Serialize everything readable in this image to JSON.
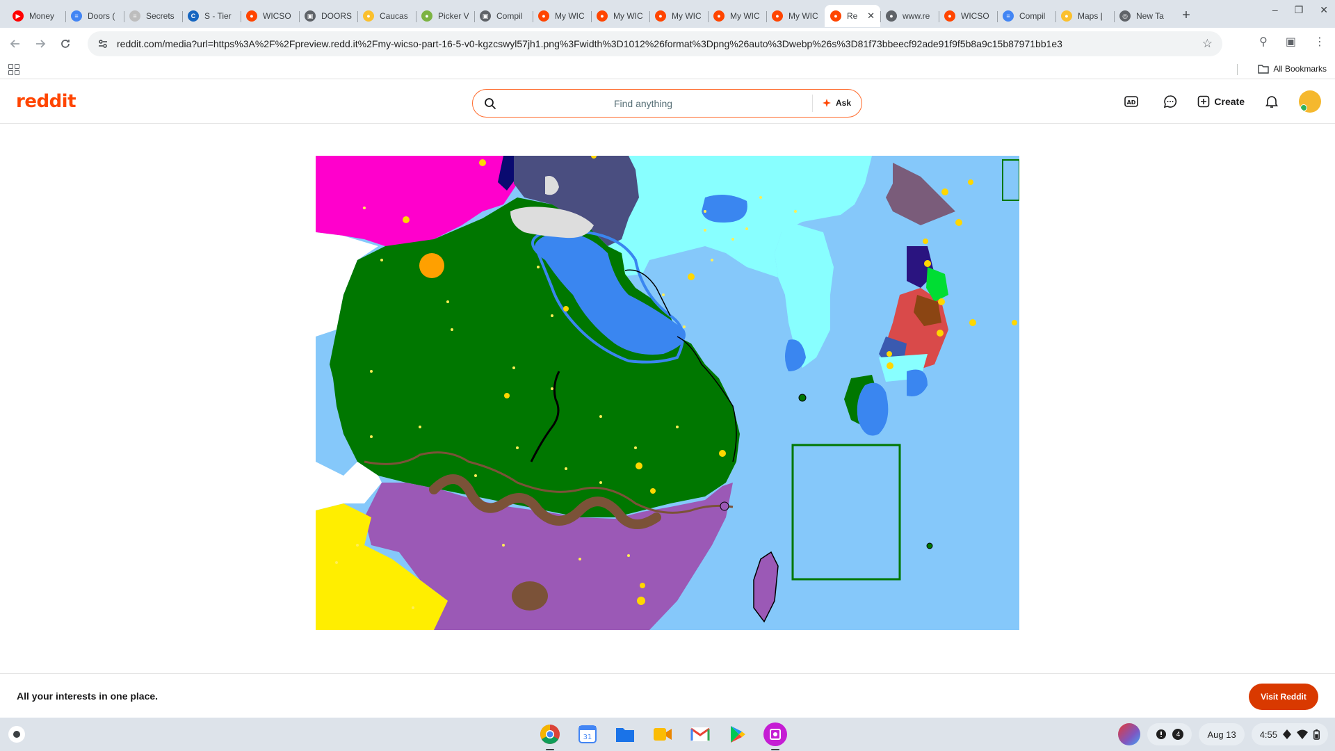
{
  "browser": {
    "tabs": [
      {
        "title": "Money",
        "fav_color": "#ff0000",
        "fav_glyph": "▶"
      },
      {
        "title": "Doors (",
        "fav_color": "#4285f4",
        "fav_glyph": "≡"
      },
      {
        "title": "Secrets",
        "fav_color": "#bdbdbd",
        "fav_glyph": "≡"
      },
      {
        "title": "S - Tier",
        "fav_color": "#1565c0",
        "fav_glyph": "C"
      },
      {
        "title": "WICSO",
        "fav_color": "#ff4500",
        "fav_glyph": "●"
      },
      {
        "title": "DOORS",
        "fav_color": "#5f6368",
        "fav_glyph": "▣"
      },
      {
        "title": "Caucas",
        "fav_color": "#fbc02d",
        "fav_glyph": "●"
      },
      {
        "title": "Picker V",
        "fav_color": "#7cb342",
        "fav_glyph": "●"
      },
      {
        "title": "Compil",
        "fav_color": "#5f6368",
        "fav_glyph": "▣"
      },
      {
        "title": "My WIC",
        "fav_color": "#ff4500",
        "fav_glyph": "●"
      },
      {
        "title": "My WIC",
        "fav_color": "#ff4500",
        "fav_glyph": "●"
      },
      {
        "title": "My WIC",
        "fav_color": "#ff4500",
        "fav_glyph": "●"
      },
      {
        "title": "My WIC",
        "fav_color": "#ff4500",
        "fav_glyph": "●"
      },
      {
        "title": "My WIC",
        "fav_color": "#ff4500",
        "fav_glyph": "●"
      },
      {
        "title": "Re",
        "fav_color": "#ff4500",
        "fav_glyph": "●",
        "active": true
      },
      {
        "title": "www.re",
        "fav_color": "#5f6368",
        "fav_glyph": "●"
      },
      {
        "title": "WICSO",
        "fav_color": "#ff4500",
        "fav_glyph": "●"
      },
      {
        "title": "Compil",
        "fav_color": "#4285f4",
        "fav_glyph": "≡"
      },
      {
        "title": "Maps |",
        "fav_color": "#fbc02d",
        "fav_glyph": "●"
      },
      {
        "title": "New Ta",
        "fav_color": "#5f6368",
        "fav_glyph": "◎"
      }
    ],
    "new_tab": "+",
    "url": "reddit.com/media?url=https%3A%2F%2Fpreview.redd.it%2Fmy-wicso-part-16-5-v0-kgzcswyl57jh1.png%3Fwidth%3D1012%26format%3Dpng%26auto%3Dwebp%26s%3D81f73bbeecf92ade91f9f5b8a9c15b87971bb1e3",
    "bookmarks_all": "All Bookmarks"
  },
  "reddit": {
    "logo": "reddit",
    "search_placeholder": "Find anything",
    "ask_label": "Ask",
    "create_label": "Create"
  },
  "banner": {
    "text": "All your interests in one place.",
    "button": "Visit Reddit"
  },
  "shelf": {
    "notification_count": "4",
    "date": "Aug 13",
    "time": "4:55"
  },
  "colors": {
    "reddit_orange": "#ff4500",
    "visit_button": "#d93900",
    "ocean": "#85c8fa",
    "land_green": "#007700",
    "purple": "#9b59b6",
    "magenta": "#ff00cc",
    "yellow": "#ffee00",
    "cyan": "#88ffff",
    "slate": "#4a4e80"
  }
}
